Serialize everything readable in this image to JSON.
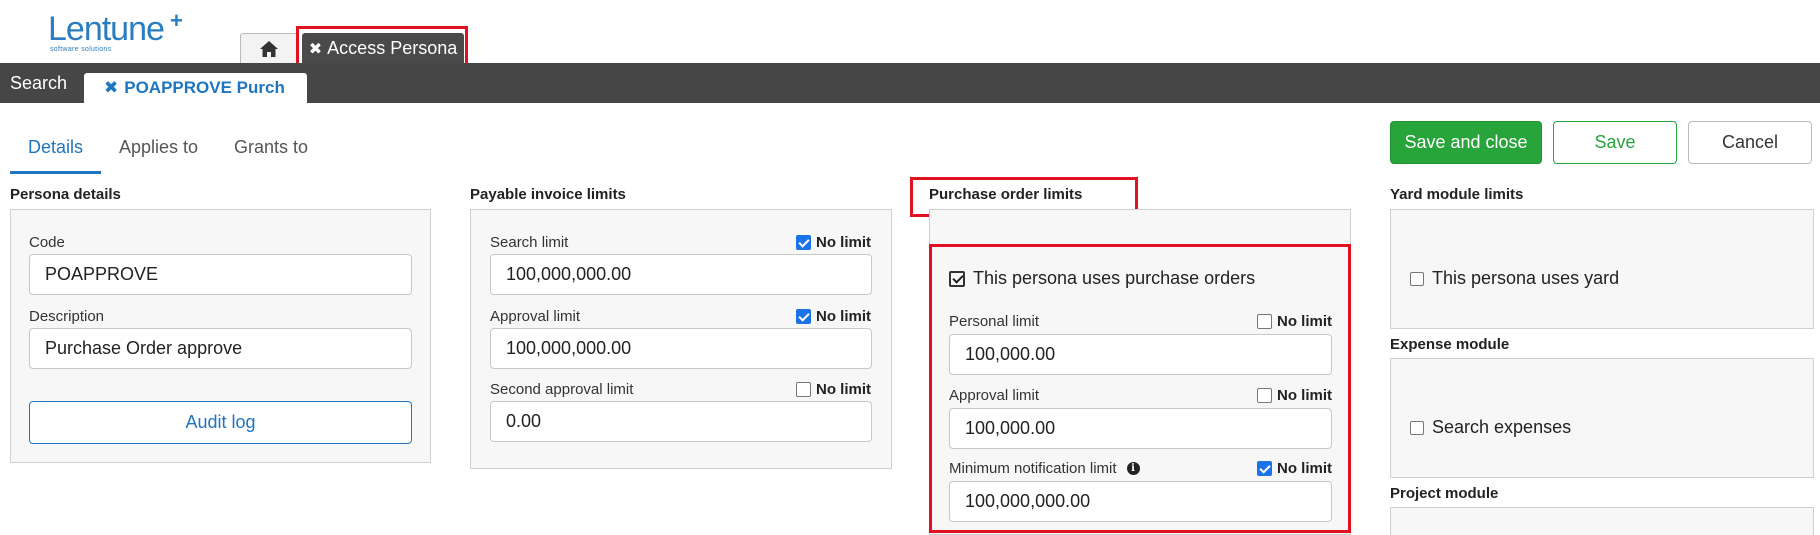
{
  "app": {
    "logo_text": "Lentune",
    "logo_plus": "+",
    "logo_sub": "software solutions"
  },
  "top_tabs": {
    "access_close": "✖",
    "access_label": "Access Persona"
  },
  "toolbar": {
    "search_label": "Search",
    "record_close": "✖",
    "record_label": "POAPPROVE Purch"
  },
  "sub_tabs": {
    "details": "Details",
    "applies_to": "Applies to",
    "grants_to": "Grants to"
  },
  "actions": {
    "save_close": "Save and close",
    "save": "Save",
    "cancel": "Cancel"
  },
  "persona_details": {
    "title": "Persona details",
    "code_label": "Code",
    "code_value": "POAPPROVE",
    "description_label": "Description",
    "description_value": "Purchase Order approve",
    "audit_log": "Audit log"
  },
  "payable_invoice": {
    "title": "Payable invoice limits",
    "search_limit_label": "Search limit",
    "search_limit_value": "100,000,000.00",
    "search_no_limit": true,
    "approval_limit_label": "Approval limit",
    "approval_limit_value": "100,000,000.00",
    "approval_no_limit": true,
    "second_approval_label": "Second approval limit",
    "second_approval_value": "0.00",
    "second_no_limit": false,
    "no_limit_label": "No limit"
  },
  "purchase_order": {
    "title": "Purchase order limits",
    "uses_label": "This persona uses purchase orders",
    "uses_checked": true,
    "personal_limit_label": "Personal limit",
    "personal_limit_value": "100,000.00",
    "personal_no_limit": false,
    "approval_limit_label": "Approval limit",
    "approval_limit_value": "100,000.00",
    "approval_no_limit": false,
    "min_notification_label": "Minimum notification limit",
    "min_notification_value": "100,000,000.00",
    "min_notification_no_limit": true,
    "no_limit_label": "No limit"
  },
  "yard_module": {
    "title": "Yard module limits",
    "uses_label": "This persona uses yard",
    "uses_checked": false
  },
  "expense_module": {
    "title": "Expense module",
    "search_label": "Search expenses",
    "search_checked": false
  },
  "project_module": {
    "title": "Project module"
  },
  "colors": {
    "accent_blue": "#1f76c0",
    "save_green": "#27a43a",
    "toolbar_dark": "#464646",
    "highlight_red": "#e3101f",
    "checkbox_blue": "#1a73e8"
  },
  "icons": {
    "home": "home-icon",
    "close": "close-icon",
    "info": "info-icon",
    "check": "check-icon"
  }
}
